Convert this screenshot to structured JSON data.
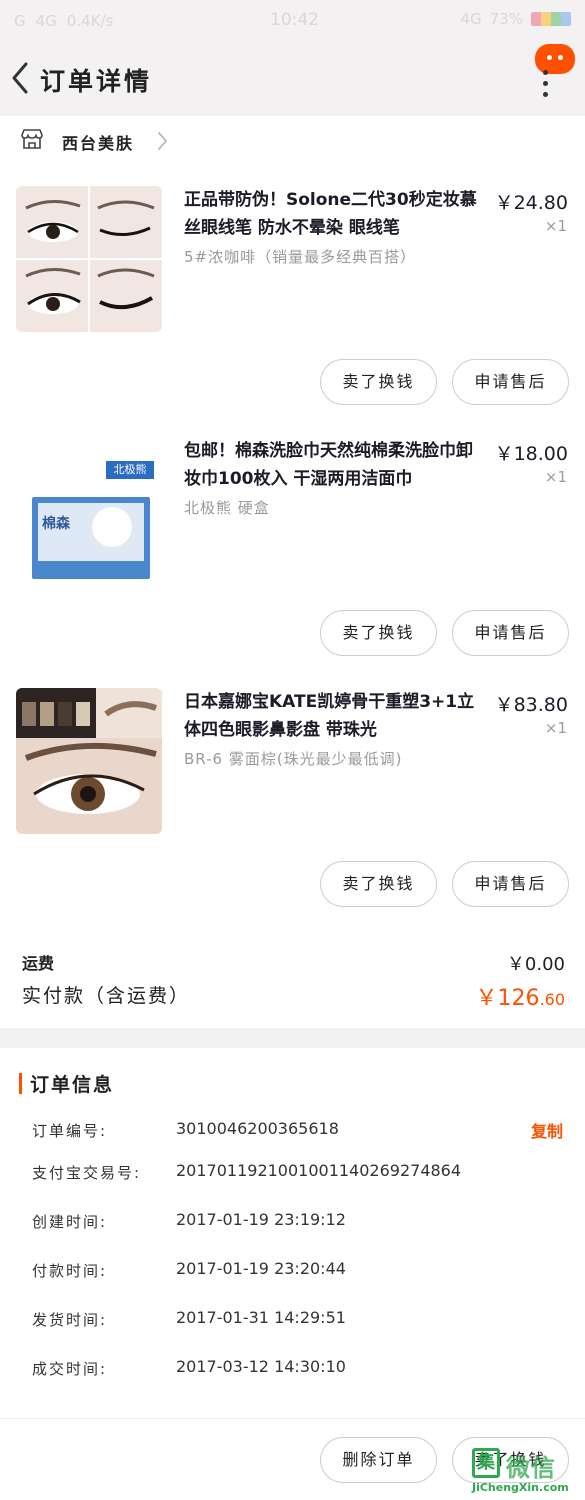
{
  "status_bar": {
    "left": [
      "G",
      "4G",
      "0.4K/s"
    ],
    "time": "10:42",
    "right": [
      "4G",
      "73%"
    ]
  },
  "header": {
    "title": "订单详情"
  },
  "shop": {
    "name": "西台美肤"
  },
  "items": [
    {
      "title": "正品带防伪！Solone二代30秒定妆慕丝眼线笔 防水不晕染 眼线笔",
      "spec": "5#浓咖啡（销量最多经典百搭）",
      "price": "￥24.80",
      "qty": "×1",
      "sell_label": "卖了换钱",
      "after_sale_label": "申请售后"
    },
    {
      "title": "包邮！棉森洗脸巾天然纯棉柔洗脸巾卸妆巾100枚入 干湿两用洁面巾",
      "spec": "北极熊 硬盒",
      "price": "￥18.00",
      "qty": "×1",
      "sell_label": "卖了换钱",
      "after_sale_label": "申请售后",
      "box_tag": "北极熊",
      "box_brand": "棉森"
    },
    {
      "title": "日本嘉娜宝KATE凯婷骨干重塑3+1立体四色眼影鼻影盘 带珠光",
      "spec": "BR-6 雾面棕(珠光最少最低调)",
      "price": "￥83.80",
      "qty": "×1",
      "sell_label": "卖了换钱",
      "after_sale_label": "申请售后"
    }
  ],
  "summary": {
    "shipping_label": "运费",
    "shipping_value": "￥0.00",
    "paid_label": "实付款（含运费）",
    "paid_value_main": "￥126",
    "paid_value_cents": ".60"
  },
  "order_info": {
    "heading": "订单信息",
    "copy_label": "复制",
    "rows": [
      {
        "label": "订单编号:",
        "value": "3010046200365618"
      },
      {
        "label": "支付宝交易号:",
        "value": "2017011921001001140269274864"
      },
      {
        "label": "创建时间:",
        "value": "2017-01-19 23:19:12"
      },
      {
        "label": "付款时间:",
        "value": "2017-01-19 23:20:44"
      },
      {
        "label": "发货时间:",
        "value": "2017-01-31 14:29:51"
      },
      {
        "label": "成交时间:",
        "value": "2017-03-12 14:30:10"
      }
    ]
  },
  "bottom_bar": {
    "delete_label": "删除订单",
    "sell_label": "卖了换钱"
  },
  "watermark": {
    "mark": "集",
    "text": "微信",
    "url": "JiChengXin.com"
  },
  "colors": {
    "accent": "#ff5000",
    "background": "#f2f2f4",
    "watermark": "#2fa84f"
  },
  "icons": [
    "back-arrow-icon",
    "chat-bubble-icon",
    "more-dots-icon",
    "shop-icon",
    "chevron-right-icon"
  ]
}
